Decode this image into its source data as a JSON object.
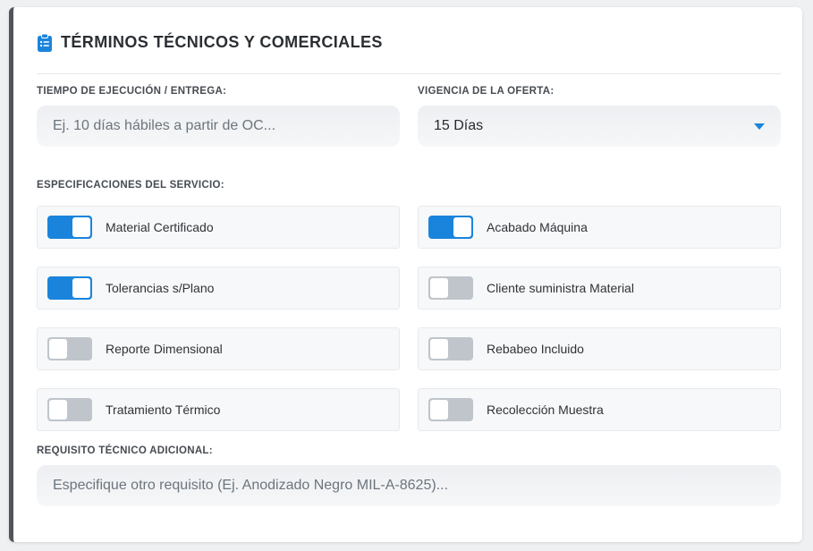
{
  "section": {
    "title": "TÉRMINOS TÉCNICOS Y COMERCIALES",
    "icon": "clipboard-list-icon",
    "accent": "#1a84dc"
  },
  "delivery": {
    "label": "TIEMPO DE EJECUCIÓN / ENTREGA:",
    "placeholder": "Ej. 10 días hábiles a partir de OC...",
    "value": ""
  },
  "validity": {
    "label": "VIGENCIA DE LA OFERTA:",
    "selected": "15 Días"
  },
  "specs": {
    "label": "ESPECIFICACIONES DEL SERVICIO:",
    "items": [
      {
        "label": "Material Certificado",
        "checked": true
      },
      {
        "label": "Acabado Máquina",
        "checked": true
      },
      {
        "label": "Tolerancias s/Plano",
        "checked": true
      },
      {
        "label": "Cliente suministra Material",
        "checked": false
      },
      {
        "label": "Reporte Dimensional",
        "checked": false
      },
      {
        "label": "Rebabeo Incluido",
        "checked": false
      },
      {
        "label": "Tratamiento Térmico",
        "checked": false
      },
      {
        "label": "Recolección Muestra",
        "checked": false
      }
    ]
  },
  "additional": {
    "label": "REQUISITO TÉCNICO ADICIONAL:",
    "placeholder": "Especifique otro requisito (Ej. Anodizado Negro MIL-A-8625)...",
    "value": ""
  }
}
